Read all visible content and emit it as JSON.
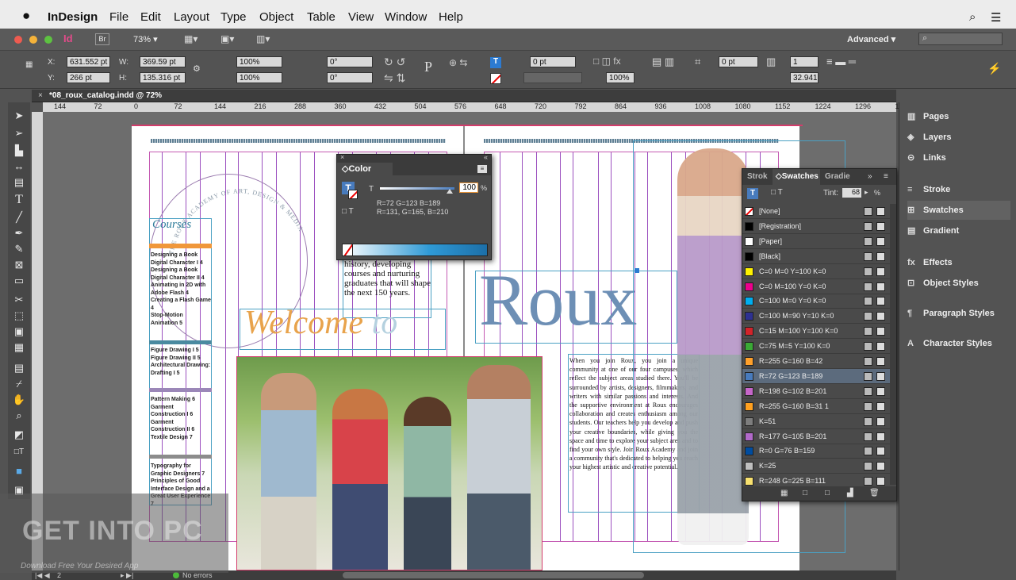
{
  "menubar": {
    "app_name": "InDesign",
    "items": [
      "File",
      "Edit",
      "Layout",
      "Type",
      "Object",
      "Table",
      "View",
      "Window",
      "Help"
    ]
  },
  "appbar": {
    "bridge": "Br",
    "zoom": "73%",
    "workspace": "Advanced",
    "search_placeholder": ""
  },
  "control": {
    "x_label": "X:",
    "x_value": "631.552 pt",
    "y_label": "Y:",
    "y_value": "266 pt",
    "w_label": "W:",
    "w_value": "369.59 pt",
    "h_label": "H:",
    "h_value": "135.316 pt",
    "scale_x": "100%",
    "scale_y": "100%",
    "rotate": "0°",
    "shear": "0°",
    "stroke_weight": "0 pt",
    "opacity": "100%",
    "offset": "0 pt",
    "columns": "1",
    "gutter": "32.941"
  },
  "doc_tab": "*08_roux_catalog.indd @ 72%",
  "ruler_ticks": [
    "144",
    "72",
    "0",
    "72",
    "144",
    "216",
    "288",
    "360",
    "432",
    "504",
    "576",
    "648",
    "720",
    "792",
    "864",
    "936",
    "1008",
    "1080",
    "1152",
    "1224",
    "1296",
    "13"
  ],
  "right_panel": {
    "items": [
      {
        "label": "Pages",
        "icon": "pages-icon",
        "glyph": "▥"
      },
      {
        "label": "Layers",
        "icon": "layers-icon",
        "glyph": "◈"
      },
      {
        "label": "Links",
        "icon": "links-icon",
        "glyph": "⊝"
      },
      {
        "label": "Stroke",
        "icon": "stroke-icon",
        "glyph": "≡"
      },
      {
        "label": "Swatches",
        "icon": "swatches-icon",
        "glyph": "⊞"
      },
      {
        "label": "Gradient",
        "icon": "gradient-icon",
        "glyph": "▤"
      },
      {
        "label": "Effects",
        "icon": "effects-icon",
        "glyph": "fx"
      },
      {
        "label": "Object Styles",
        "icon": "object-styles-icon",
        "glyph": "⊡"
      },
      {
        "label": "Paragraph Styles",
        "icon": "paragraph-styles-icon",
        "glyph": "¶"
      },
      {
        "label": "Character Styles",
        "icon": "character-styles-icon",
        "glyph": "A"
      }
    ]
  },
  "color_panel": {
    "title": "Color",
    "tint_label": "T",
    "tint_value": "100",
    "tint_pct": "%",
    "tint_level": 1.0,
    "rgb_line1": "R=72 G=123 B=189",
    "rgb_line2": "R=131, G=165, B=210"
  },
  "swatches_panel": {
    "tabs": [
      "Strok",
      "Swatches",
      "Gradie"
    ],
    "tint_label": "Tint:",
    "tint_value": "68",
    "tint_pct": "%",
    "rows": [
      {
        "name": "[None]",
        "color": "#ffffff"
      },
      {
        "name": "[Registration]",
        "color": "#000000"
      },
      {
        "name": "[Paper]",
        "color": "#ffffff"
      },
      {
        "name": "[Black]",
        "color": "#000000"
      },
      {
        "name": "C=0 M=0 Y=100 K=0",
        "color": "#fff200"
      },
      {
        "name": "C=0 M=100 Y=0 K=0",
        "color": "#ec008c"
      },
      {
        "name": "C=100 M=0 Y=0 K=0",
        "color": "#00aeef"
      },
      {
        "name": "C=100 M=90 Y=10 K=0",
        "color": "#2e3192"
      },
      {
        "name": "C=15 M=100 Y=100 K=0",
        "color": "#d2232a"
      },
      {
        "name": "C=75 M=5 Y=100 K=0",
        "color": "#3aa935"
      },
      {
        "name": "R=255 G=160 B=42",
        "color": "#ffa02a"
      },
      {
        "name": "R=72 G=123 B=189",
        "color": "#487bbd"
      },
      {
        "name": "R=198 G=102 B=201",
        "color": "#c666c9"
      },
      {
        "name": "R=255 G=160 B=31 1",
        "color": "#ffa01f"
      },
      {
        "name": "K=51",
        "color": "#7d7d7d"
      },
      {
        "name": "R=177 G=105 B=201",
        "color": "#b169c9"
      },
      {
        "name": "R=0 G=76 B=159",
        "color": "#004c9f"
      },
      {
        "name": "K=25",
        "color": "#bfbfbf"
      },
      {
        "name": "R=248 G=225 B=111",
        "color": "#f8e16f"
      }
    ],
    "selected_row": 11
  },
  "document": {
    "arc_text": "THE ROUX ACADEMY OF ART, DESIGN & MEDIA",
    "courses_heading": "Courses",
    "course_groups": [
      [
        "Designing a Book",
        "Digital Character I  4",
        "Designing a Book",
        "Digital Character II  4",
        "Animating in 2D with",
        "Adobe Flash  4",
        "Creating a Flash Game  4",
        "Stop-Motion",
        "Animation  5"
      ],
      [
        "Figure Drawing I  5",
        "Figure Drawing II  5",
        "Architectural Drawing:",
        "Drafting I  5"
      ],
      [
        "Pattern Making  6",
        "Garment",
        "Construction I  6",
        "Garment",
        "Construction II  6",
        "Textile Design  7"
      ],
      [
        "Typography for",
        "Graphic Designers  7",
        "Principles of Good",
        "Interface Design and a",
        "Great User Experience  7"
      ]
    ],
    "intro_text": "history, developing courses and nurturing graduates that will shape the next 150 years.",
    "welcome": "Welcome",
    "welcome_to": "to",
    "roux": "Roux",
    "body_text": "When you join Roux, you join a unique community at one of our four campuses, which reflect the subject areas studied there. You'll be surrounded by artists, designers, filmmakers, and writers with similar passions and interests. And the supportive environment at Roux encourages collaboration and creates enthusiasm among our students. Our teachers help you develop and push your creative boundaries, while giving you the space and time to explore your subject area and to find your own style. Join Roux Academy and join a community that's dedicated to helping you reach your highest artistic and creative potential."
  },
  "status": {
    "page": "2",
    "errors": "No errors"
  },
  "watermark": {
    "main": "GET INTO PC",
    "sub": "Download Free Your Desired App"
  }
}
